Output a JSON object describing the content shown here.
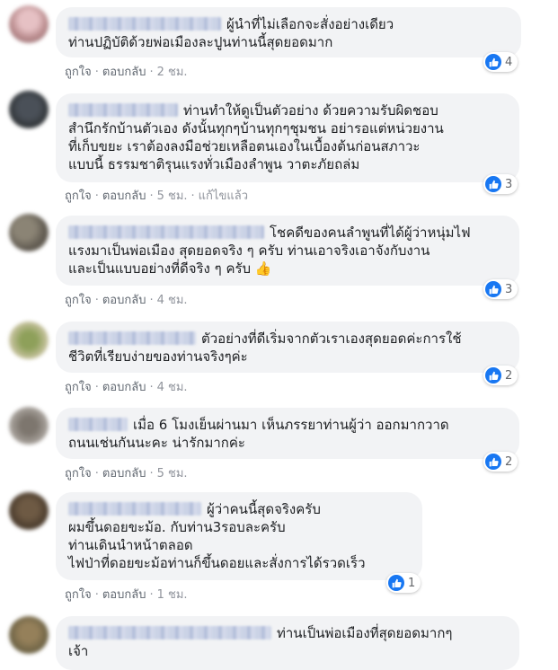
{
  "colors": {
    "link": "#606770",
    "bubble": "#f2f3f5",
    "like": "#1877f2"
  },
  "comments": [
    {
      "text": "ผู้นำที่ไม่เลือกจะสั่งอย่างเดียว\nท่านปฏิบัติด้วยพ่อเมืองละปูนท่านนี้สุดยอดมาก",
      "like": "ถูกใจ",
      "reply": "ตอบกลับ",
      "time": "2 ชม.",
      "edited": "",
      "reactions": "4"
    },
    {
      "text": "ท่านทำให้ดูเป็นตัวอย่าง ด้วยความรับผิดชอบ\nสำนึกรักบ้านตัวเอง ดังนั้นทุกๆบ้านทุกๆชุมชน อย่ารอแต่หน่วยงาน\nที่เก็บขยะ เราต้องลงมือช่วยเหลือตนเองในเบื้องต้นก่อนสภาวะ\nแบบนี้ ธรรมชาติรุนแรงทั่วเมืองลำพูน วาตะภัยถล่ม",
      "like": "ถูกใจ",
      "reply": "ตอบกลับ",
      "time": "5 ชม.",
      "edited": "แก้ไขแล้ว",
      "reactions": "3"
    },
    {
      "text": "โชคดีของคนลำพูนที่ได้ผู้ว่าหนุ่มไฟ\nแรงมาเป็นพ่อเมือง สุดยอดจริง ๆ ครับ ท่านเอาจริงเอาจังกับงาน\nและเป็นแบบอย่างที่ดีจริง ๆ ครับ",
      "emoji": "👍",
      "like": "ถูกใจ",
      "reply": "ตอบกลับ",
      "time": "4 ชม.",
      "edited": "",
      "reactions": "3"
    },
    {
      "text": "ตัวอย่างที่ดีเริ่มจากตัวเราเองสุดยอดค่ะการใช้\nชีวิตที่เรียบง่ายของท่านจริงๆค่ะ",
      "like": "ถูกใจ",
      "reply": "ตอบกลับ",
      "time": "4 ชม.",
      "edited": "",
      "reactions": "2"
    },
    {
      "text": "เมื่อ 6 โมงเย็นผ่านมา เห็นภรรยาท่านผู้ว่า ออกมากวาด\nถนนเช่นกันนะคะ น่ารักมากค่ะ",
      "like": "ถูกใจ",
      "reply": "ตอบกลับ",
      "time": "5 ชม.",
      "edited": "",
      "reactions": "2"
    },
    {
      "text": "ผู้ว่าคนนี้สุดจริงครับ\nผมขึ้นดอยขะม้อ. กับท่าน3รอบละครับ\nท่านเดินนำหน้าตลอด\nไฟป่าที่ดอยขะม้อท่านก็ขึ้นดอยและสั่งการได้รวดเร็ว",
      "like": "ถูกใจ",
      "reply": "ตอบกลับ",
      "time": "1 ชม.",
      "edited": "",
      "reactions": "1"
    },
    {
      "text": "ท่านเป็นพ่อเมืองที่สุดยอดมากๆ\nเจ้า",
      "like": "",
      "reply": "",
      "time": "",
      "edited": "",
      "reactions": ""
    }
  ]
}
